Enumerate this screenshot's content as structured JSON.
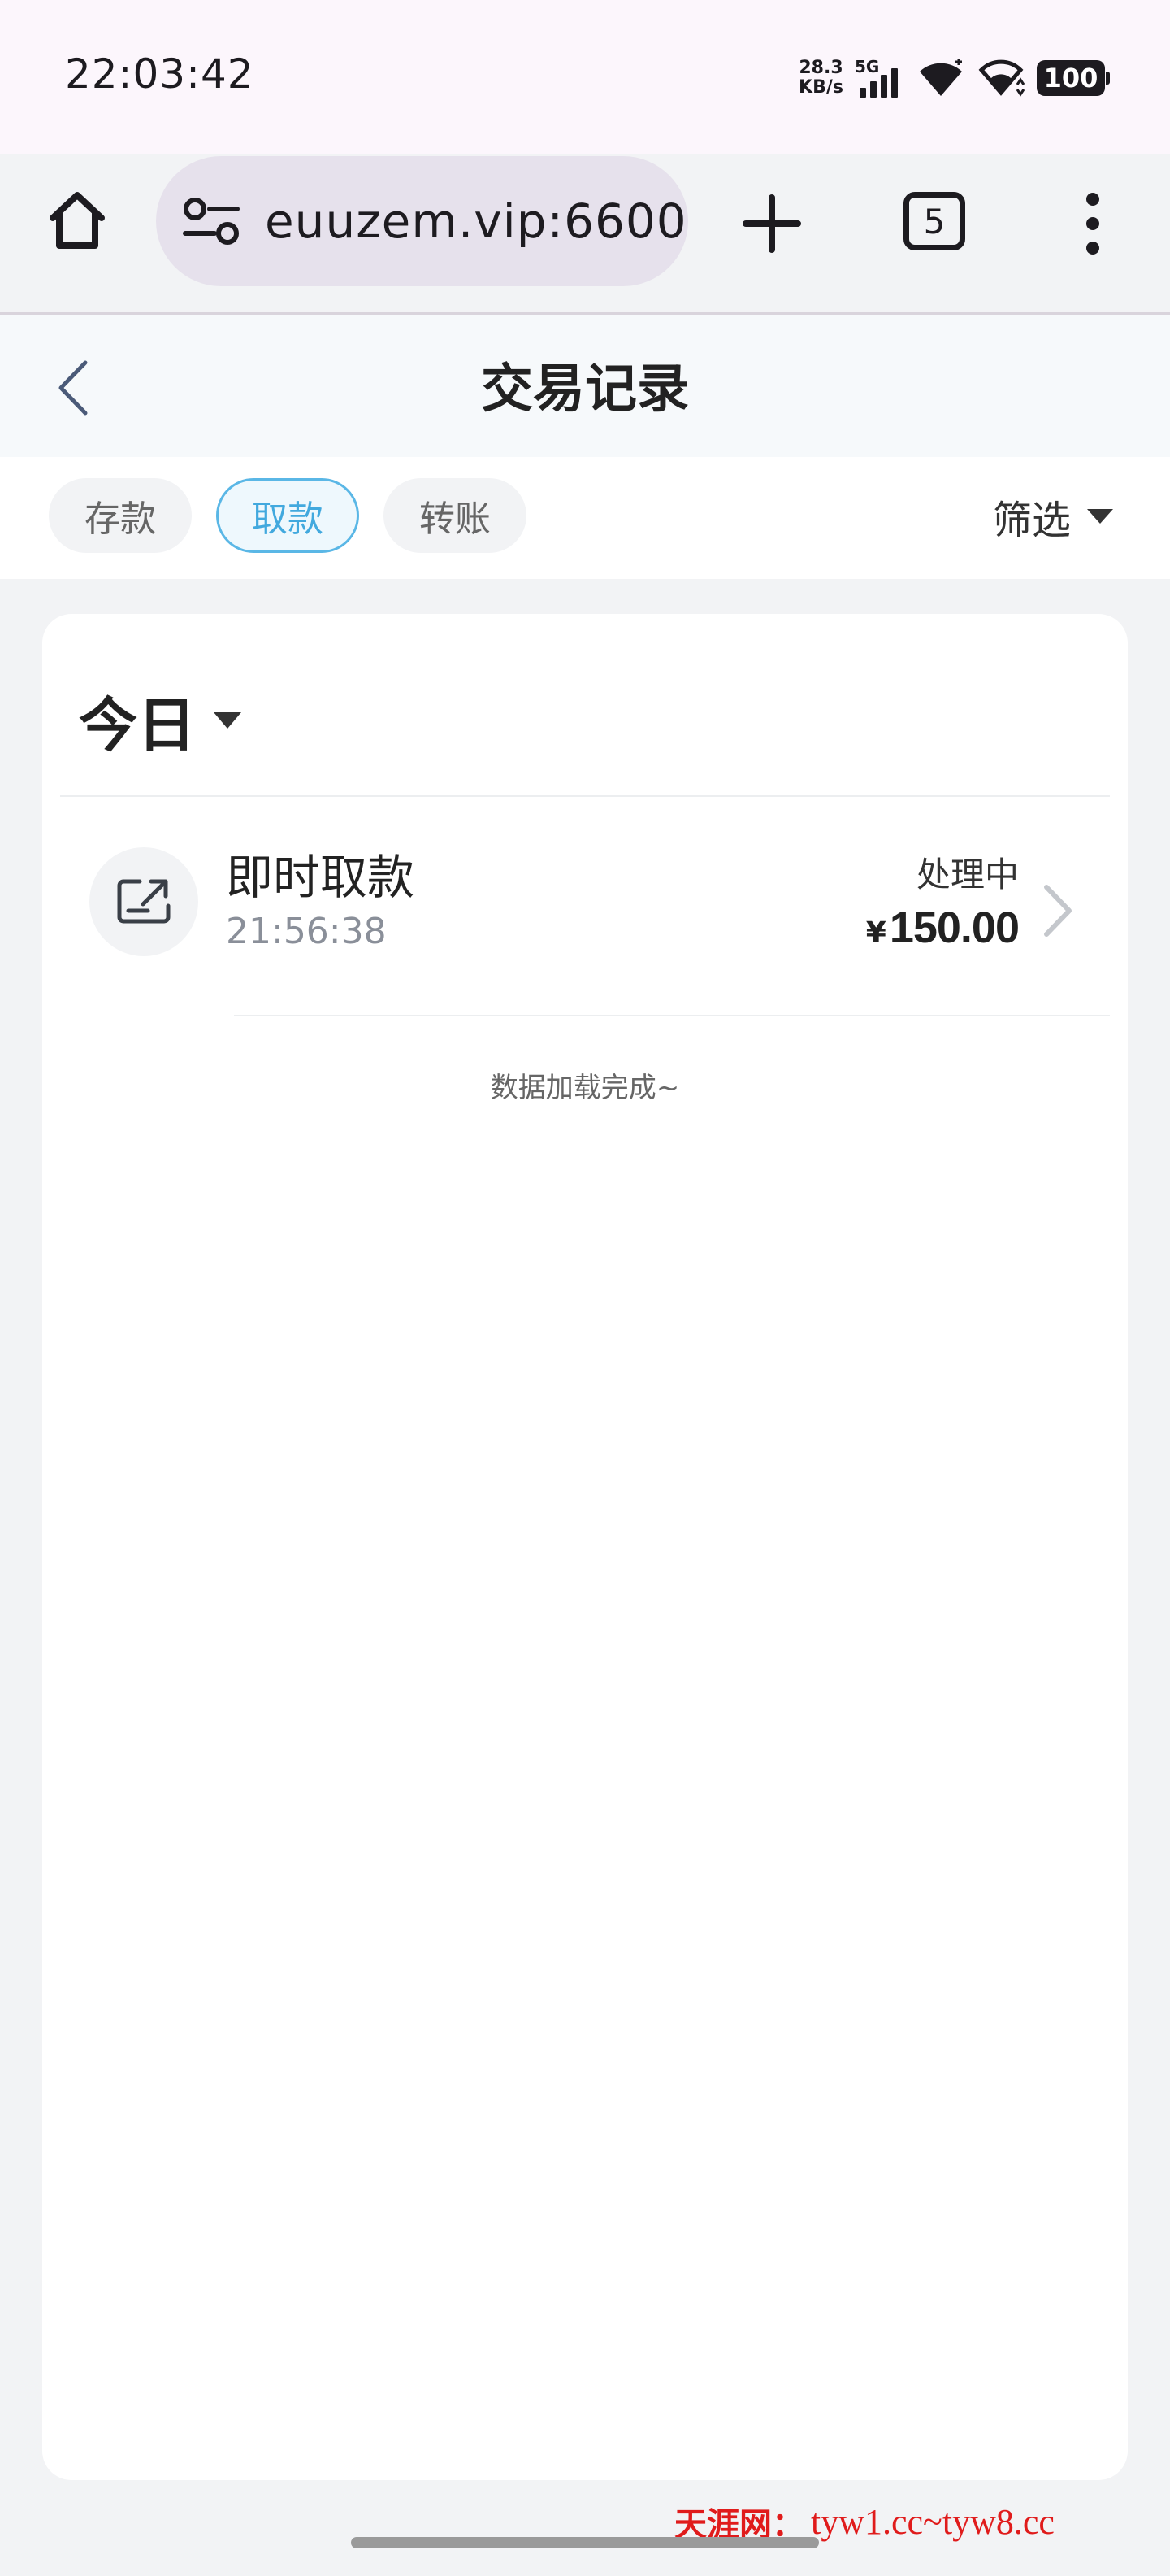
{
  "status_bar": {
    "time": "22:03:42",
    "net_speed_value": "28.3",
    "net_speed_unit": "KB/s",
    "network_type": "5G",
    "battery": "100"
  },
  "browser": {
    "url": "euuzem.vip:6600",
    "tab_count": "5",
    "icons": [
      "home-icon",
      "site-settings-icon",
      "plus-icon",
      "more-vert-icon"
    ]
  },
  "header": {
    "title": "交易记录"
  },
  "tabs": [
    {
      "label": "存款",
      "active": false
    },
    {
      "label": "取款",
      "active": true
    },
    {
      "label": "转账",
      "active": false
    }
  ],
  "filter": {
    "label": "筛选"
  },
  "list": {
    "group_label": "今日",
    "records": [
      {
        "title": "即时取款",
        "time": "21:56:38",
        "status": "处理中",
        "currency": "¥",
        "amount": "150.00"
      }
    ],
    "end_text": "数据加载完成~"
  },
  "watermark": {
    "site_name": "天涯网：",
    "urls": "tyw1.cc~tyw8.cc"
  },
  "colors": {
    "accent": "#42a9de",
    "status_bar_bg": "#fcf6fc",
    "url_pill_bg": "#e6e1ec",
    "watermark": "#e01b1b"
  }
}
